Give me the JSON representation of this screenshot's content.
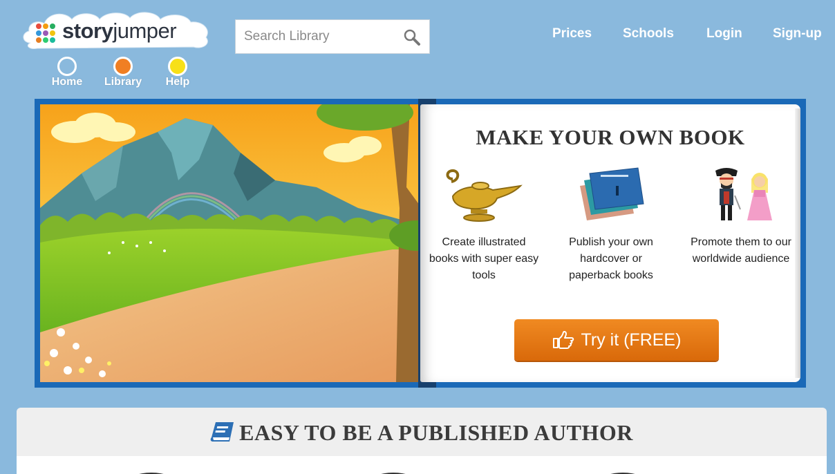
{
  "brand": {
    "name_part1": "story",
    "name_part2": "jumper",
    "dot_colors": [
      "#e84c3d",
      "#f39c12",
      "#27ae60",
      "#3498db",
      "#9b59b6",
      "#f1c40f",
      "#e67e22",
      "#2ecc71",
      "#1abc9c"
    ]
  },
  "search": {
    "placeholder": "Search Library",
    "icon": "search-icon"
  },
  "top_nav": [
    {
      "label": "Prices"
    },
    {
      "label": "Schools"
    },
    {
      "label": "Login"
    },
    {
      "label": "Sign-up"
    }
  ],
  "circle_nav": [
    {
      "label": "Home",
      "color": "#8ab9dd"
    },
    {
      "label": "Library",
      "color": "#f07f23"
    },
    {
      "label": "Help",
      "color": "#f7e018"
    }
  ],
  "hero": {
    "title": "MAKE YOUR OWN BOOK",
    "features": [
      {
        "icon": "magic-lamp-icon",
        "text": "Create illustrated books with super easy tools"
      },
      {
        "icon": "books-icon",
        "text": "Publish your own hardcover or paperback books"
      },
      {
        "icon": "characters-icon",
        "text": "Promote them to our worldwide audience"
      }
    ],
    "cta_label": "Try it (FREE)",
    "cta_icon": "hand-pointing-icon"
  },
  "section": {
    "title": "EASY TO BE A PUBLISHED AUTHOR",
    "icon": "book-icon"
  },
  "colors": {
    "background": "#8ab9dd",
    "book_cover": "#1a69b7",
    "cta": "#e8781a"
  }
}
